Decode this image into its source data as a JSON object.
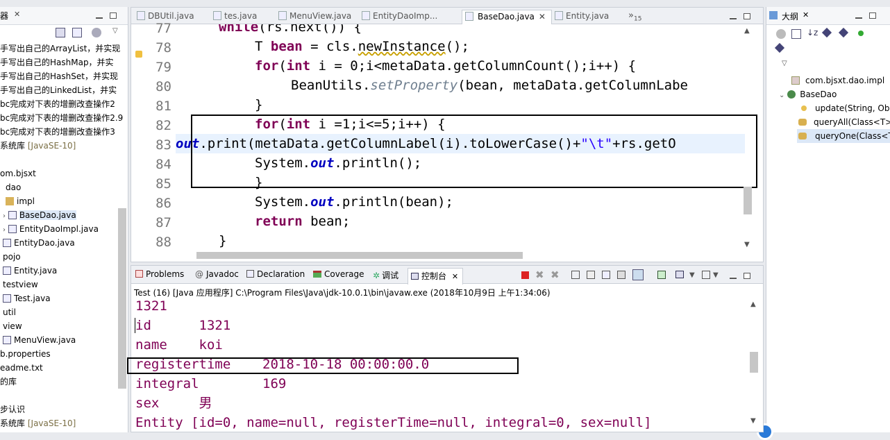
{
  "left_panel": {
    "title": "器",
    "items": [
      {
        "label": "手写出自己的ArrayList，并实现"
      },
      {
        "label": "手写出自己的HashMap，并实"
      },
      {
        "label": "手写出自己的HashSet，并实现"
      },
      {
        "label": "手写出自己的LinkedList，并实"
      },
      {
        "label": "bc完成对下表的增删改查操作2"
      },
      {
        "label": "bc完成对下表的增删改查操作2.9"
      },
      {
        "label": "bc完成对下表的增删改查操作3"
      },
      {
        "label": "系统库",
        "suffix": "[JavaSE-10]"
      },
      {
        "label": "om.bjsxt"
      },
      {
        "label": "dao"
      },
      {
        "label": "impl"
      },
      {
        "label": "BaseDao.java"
      },
      {
        "label": "EntityDaoImpl.java"
      },
      {
        "label": "EntityDao.java"
      },
      {
        "label": "pojo"
      },
      {
        "label": "Entity.java"
      },
      {
        "label": "testview"
      },
      {
        "label": "Test.java"
      },
      {
        "label": "util"
      },
      {
        "label": "view"
      },
      {
        "label": "MenuView.java"
      },
      {
        "label": "b.properties"
      },
      {
        "label": "eadme.txt"
      },
      {
        "label": "的库"
      },
      {
        "label": "步认识"
      },
      {
        "label": "系统库",
        "suffix": "[JavaSE-10]"
      }
    ]
  },
  "editor": {
    "tabs": [
      {
        "label": "DBUtil.java"
      },
      {
        "label": "tes.java"
      },
      {
        "label": "MenuView.java"
      },
      {
        "label": "EntityDaoImp..."
      },
      {
        "label": "BaseDao.java",
        "active": true
      },
      {
        "label": "Entity.java"
      }
    ],
    "overflow_label": "»",
    "overflow_count": "15",
    "line_numbers": [
      "77",
      "78",
      "79",
      "80",
      "81",
      "82",
      "83",
      "84",
      "85",
      "86",
      "87",
      "88"
    ]
  },
  "outline": {
    "title": "大纲",
    "items": [
      {
        "label": "com.bjsxt.dao.impl"
      },
      {
        "label": "BaseDao"
      },
      {
        "label": "update(String, Ob"
      },
      {
        "label": "queryAll(Class<T>"
      },
      {
        "label": "queryOne(Class<T"
      }
    ]
  },
  "console": {
    "tabs": [
      {
        "label": "Problems"
      },
      {
        "label": "Javadoc"
      },
      {
        "label": "Declaration"
      },
      {
        "label": "Coverage"
      },
      {
        "label": "调试"
      },
      {
        "label": "控制台",
        "active": true
      }
    ],
    "info": "Test (16)  [Java 应用程序] C:\\Program Files\\Java\\jdk-10.0.1\\bin\\javaw.exe  (2018年10月9日 上午1:34:06)",
    "lines": [
      "1321",
      "id      1321",
      "name    koi",
      "registertime    2018-10-18 00:00:00.0",
      "integral        169",
      "sex     男",
      "Entity [id=0, name=null, registerTime=null, integral=0, sex=null]"
    ]
  },
  "colors": {
    "keyword": "#7f0055",
    "field": "#0000c0",
    "string": "#2a00ff",
    "console_text": "#7f0055"
  }
}
